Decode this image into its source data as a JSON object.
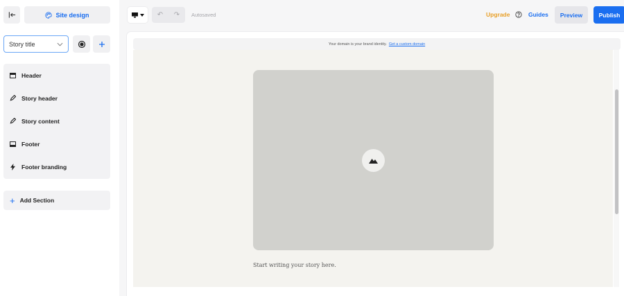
{
  "sidebar": {
    "site_design_label": "Site design",
    "story_select_value": "Story title",
    "sections": [
      {
        "label": "Header",
        "icon": "layout-header-icon"
      },
      {
        "label": "Story header",
        "icon": "pencil-icon"
      },
      {
        "label": "Story content",
        "icon": "pencil-icon"
      },
      {
        "label": "Footer",
        "icon": "layout-footer-icon"
      },
      {
        "label": "Footer branding",
        "icon": "lightning-icon"
      }
    ],
    "add_section_label": "Add Section"
  },
  "topbar": {
    "autosaved_label": "Autosaved",
    "upgrade_label": "Upgrade",
    "guides_label": "Guides",
    "preview_label": "Preview",
    "publish_label": "Publish"
  },
  "canvas": {
    "domain_notice": "Your domain is your brand identity.",
    "domain_link": "Get a custom domain",
    "story_placeholder": "Start writing your story here."
  },
  "colors": {
    "accent": "#1a6ef0",
    "upgrade": "#e8a02a",
    "story_bg": "#f4f3ef",
    "image_placeholder": "#d1d1cd"
  }
}
